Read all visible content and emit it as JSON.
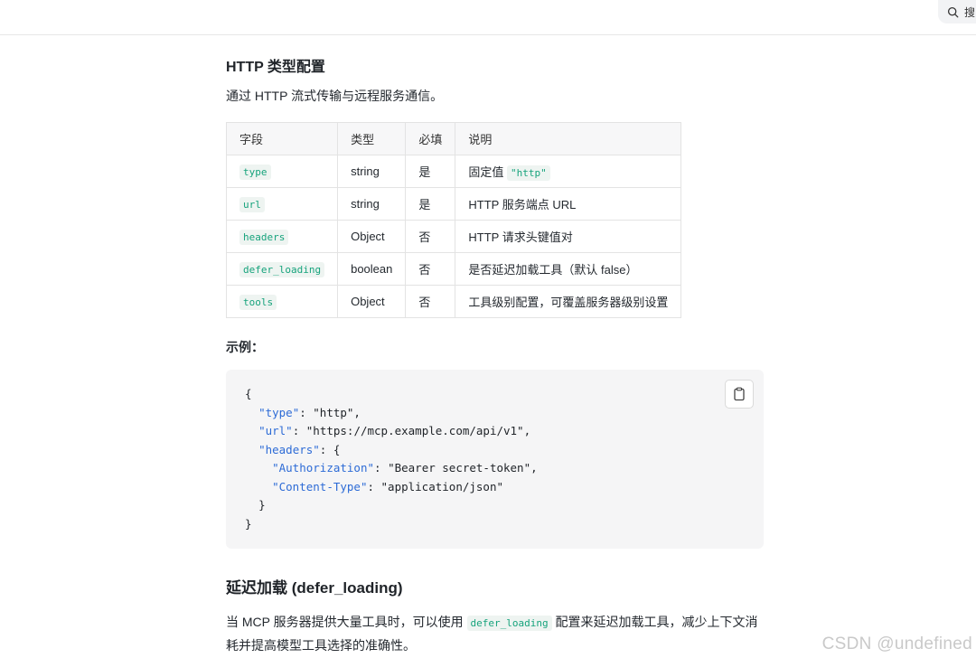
{
  "search": {
    "label": "搜"
  },
  "section1": {
    "title": "HTTP 类型配置",
    "intro": "通过 HTTP 流式传输与远程服务通信。"
  },
  "table": {
    "headers": [
      "字段",
      "类型",
      "必填",
      "说明"
    ],
    "rows": [
      {
        "field": "type",
        "type": "string",
        "required": "是",
        "desc_text": "固定值",
        "desc_code": "\"http\""
      },
      {
        "field": "url",
        "type": "string",
        "required": "是",
        "desc_text": "HTTP 服务端点 URL",
        "desc_code": ""
      },
      {
        "field": "headers",
        "type": "Object",
        "required": "否",
        "desc_text": "HTTP 请求头键值对",
        "desc_code": ""
      },
      {
        "field": "defer_loading",
        "type": "boolean",
        "required": "否",
        "desc_text": "是否延迟加载工具（默认 false）",
        "desc_code": ""
      },
      {
        "field": "tools",
        "type": "Object",
        "required": "否",
        "desc_text": "工具级别配置，可覆盖服务器级别设置",
        "desc_code": ""
      }
    ]
  },
  "example": {
    "label": "示例：",
    "lines": [
      {
        "indent": 0,
        "key": "",
        "sep": "",
        "value": "{"
      },
      {
        "indent": 1,
        "key": "\"type\"",
        "sep": ": ",
        "value": "\"http\","
      },
      {
        "indent": 1,
        "key": "\"url\"",
        "sep": ": ",
        "value": "\"https://mcp.example.com/api/v1\","
      },
      {
        "indent": 1,
        "key": "\"headers\"",
        "sep": ": ",
        "value": "{"
      },
      {
        "indent": 2,
        "key": "\"Authorization\"",
        "sep": ": ",
        "value": "\"Bearer secret-token\","
      },
      {
        "indent": 2,
        "key": "\"Content-Type\"",
        "sep": ": ",
        "value": "\"application/json\""
      },
      {
        "indent": 1,
        "key": "",
        "sep": "",
        "value": "}"
      },
      {
        "indent": 0,
        "key": "",
        "sep": "",
        "value": "}"
      }
    ],
    "copy_icon": "clipboard-icon"
  },
  "section2": {
    "title": "延迟加载 (defer_loading)",
    "para_before": "当 MCP 服务器提供大量工具时，可以使用 ",
    "para_code": "defer_loading",
    "para_after": " 配置来延迟加载工具，减少上下文消耗并提高模型工具选择的准确性。"
  },
  "watermark": "CSDN @undefined"
}
